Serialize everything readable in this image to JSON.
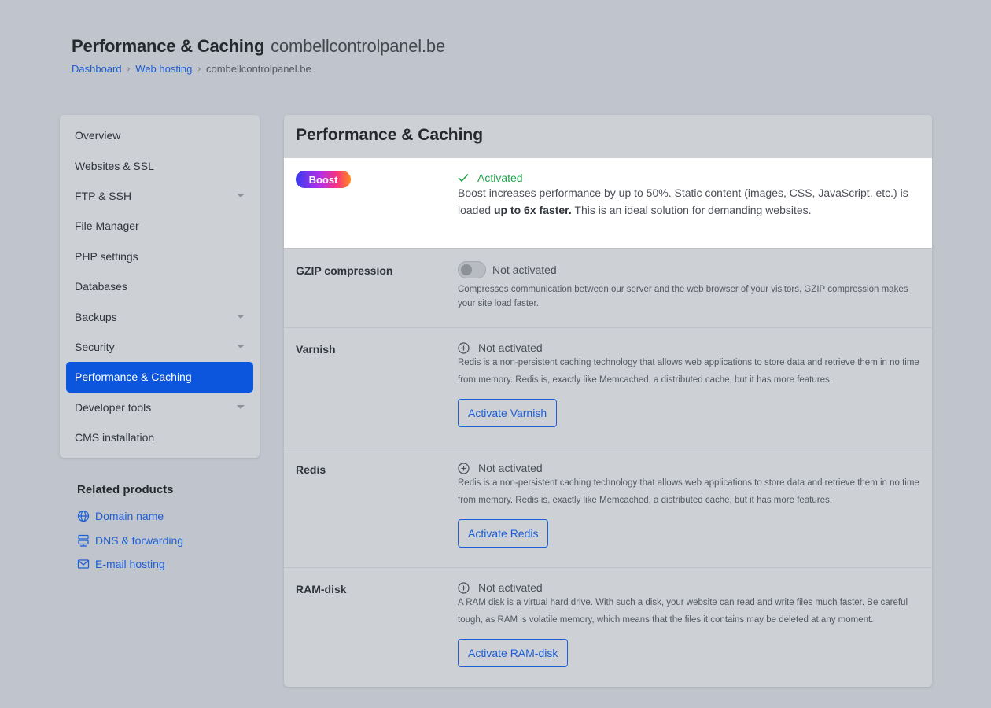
{
  "header": {
    "title": "Performance & Caching",
    "domain": "combellcontrolpanel.be",
    "breadcrumb": [
      "Dashboard",
      "Web hosting",
      "combellcontrolpanel.be"
    ]
  },
  "sidebar": {
    "items": [
      {
        "label": "Overview",
        "caret": false
      },
      {
        "label": "Websites & SSL",
        "caret": false
      },
      {
        "label": "FTP & SSH",
        "caret": true
      },
      {
        "label": "File Manager",
        "caret": false
      },
      {
        "label": "PHP settings",
        "caret": false
      },
      {
        "label": "Databases",
        "caret": false
      },
      {
        "label": "Backups",
        "caret": true
      },
      {
        "label": "Security",
        "caret": true
      },
      {
        "label": "Performance & Caching",
        "caret": false,
        "active": true
      },
      {
        "label": "Developer tools",
        "caret": true
      },
      {
        "label": "CMS installation",
        "caret": false
      }
    ]
  },
  "related": {
    "title": "Related products",
    "items": [
      {
        "label": "Domain name",
        "icon": "globe-icon"
      },
      {
        "label": "DNS & forwarding",
        "icon": "server-icon"
      },
      {
        "label": "E-mail hosting",
        "icon": "mail-icon"
      }
    ]
  },
  "panel": {
    "title": "Performance & Caching",
    "boost": {
      "badge": "Boost",
      "status": "Activated",
      "desc_a": "Boost increases performance by up to 50%. Static content (images, CSS, JavaScript, etc.) is loaded ",
      "desc_bold": "up to 6x faster.",
      "desc_b": " This is an ideal solution for demanding websites."
    },
    "gzip": {
      "label": "GZIP compression",
      "status": "Not activated",
      "desc": "Compresses communication between our server and the web browser of your visitors. GZIP compression makes your site load faster."
    },
    "varnish": {
      "label": "Varnish",
      "status": "Not activated",
      "desc": "Redis is a non-persistent caching technology that allows web applications to store data and retrieve them in no time from memory. Redis is, exactly like Memcached, a distributed cache, but it has more features.",
      "button": "Activate Varnish"
    },
    "redis": {
      "label": "Redis",
      "status": "Not activated",
      "desc": "Redis is a non-persistent caching technology that allows web applications to store data and retrieve them in no time from memory. Redis is, exactly like Memcached, a distributed cache, but it has more features.",
      "button": "Activate Redis"
    },
    "ramdisk": {
      "label": "RAM-disk",
      "status": "Not activated",
      "desc": "A RAM disk is a virtual hard drive. With such a disk, your website can read and write files much faster. Be careful tough, as RAM is volatile memory, which means that the files it contains may be deleted at any moment.",
      "button": "Activate RAM-disk"
    }
  }
}
